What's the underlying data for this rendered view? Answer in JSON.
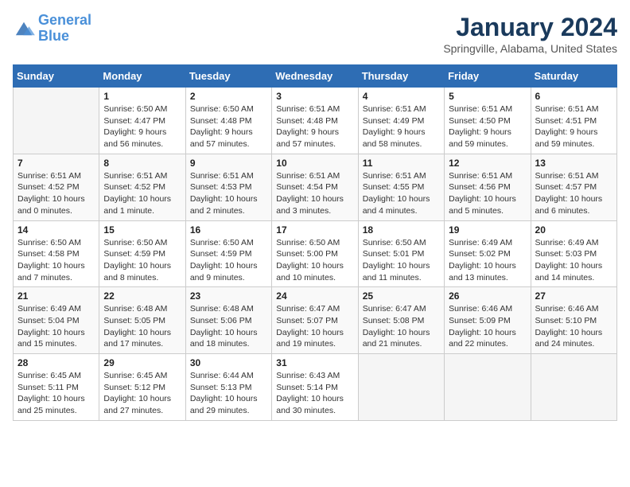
{
  "header": {
    "logo_line1": "General",
    "logo_line2": "Blue",
    "title": "January 2024",
    "subtitle": "Springville, Alabama, United States"
  },
  "weekdays": [
    "Sunday",
    "Monday",
    "Tuesday",
    "Wednesday",
    "Thursday",
    "Friday",
    "Saturday"
  ],
  "weeks": [
    [
      {
        "day": "",
        "info": ""
      },
      {
        "day": "1",
        "info": "Sunrise: 6:50 AM\nSunset: 4:47 PM\nDaylight: 9 hours\nand 56 minutes."
      },
      {
        "day": "2",
        "info": "Sunrise: 6:50 AM\nSunset: 4:48 PM\nDaylight: 9 hours\nand 57 minutes."
      },
      {
        "day": "3",
        "info": "Sunrise: 6:51 AM\nSunset: 4:48 PM\nDaylight: 9 hours\nand 57 minutes."
      },
      {
        "day": "4",
        "info": "Sunrise: 6:51 AM\nSunset: 4:49 PM\nDaylight: 9 hours\nand 58 minutes."
      },
      {
        "day": "5",
        "info": "Sunrise: 6:51 AM\nSunset: 4:50 PM\nDaylight: 9 hours\nand 59 minutes."
      },
      {
        "day": "6",
        "info": "Sunrise: 6:51 AM\nSunset: 4:51 PM\nDaylight: 9 hours\nand 59 minutes."
      }
    ],
    [
      {
        "day": "7",
        "info": "Sunrise: 6:51 AM\nSunset: 4:52 PM\nDaylight: 10 hours\nand 0 minutes."
      },
      {
        "day": "8",
        "info": "Sunrise: 6:51 AM\nSunset: 4:52 PM\nDaylight: 10 hours\nand 1 minute."
      },
      {
        "day": "9",
        "info": "Sunrise: 6:51 AM\nSunset: 4:53 PM\nDaylight: 10 hours\nand 2 minutes."
      },
      {
        "day": "10",
        "info": "Sunrise: 6:51 AM\nSunset: 4:54 PM\nDaylight: 10 hours\nand 3 minutes."
      },
      {
        "day": "11",
        "info": "Sunrise: 6:51 AM\nSunset: 4:55 PM\nDaylight: 10 hours\nand 4 minutes."
      },
      {
        "day": "12",
        "info": "Sunrise: 6:51 AM\nSunset: 4:56 PM\nDaylight: 10 hours\nand 5 minutes."
      },
      {
        "day": "13",
        "info": "Sunrise: 6:51 AM\nSunset: 4:57 PM\nDaylight: 10 hours\nand 6 minutes."
      }
    ],
    [
      {
        "day": "14",
        "info": "Sunrise: 6:50 AM\nSunset: 4:58 PM\nDaylight: 10 hours\nand 7 minutes."
      },
      {
        "day": "15",
        "info": "Sunrise: 6:50 AM\nSunset: 4:59 PM\nDaylight: 10 hours\nand 8 minutes."
      },
      {
        "day": "16",
        "info": "Sunrise: 6:50 AM\nSunset: 4:59 PM\nDaylight: 10 hours\nand 9 minutes."
      },
      {
        "day": "17",
        "info": "Sunrise: 6:50 AM\nSunset: 5:00 PM\nDaylight: 10 hours\nand 10 minutes."
      },
      {
        "day": "18",
        "info": "Sunrise: 6:50 AM\nSunset: 5:01 PM\nDaylight: 10 hours\nand 11 minutes."
      },
      {
        "day": "19",
        "info": "Sunrise: 6:49 AM\nSunset: 5:02 PM\nDaylight: 10 hours\nand 13 minutes."
      },
      {
        "day": "20",
        "info": "Sunrise: 6:49 AM\nSunset: 5:03 PM\nDaylight: 10 hours\nand 14 minutes."
      }
    ],
    [
      {
        "day": "21",
        "info": "Sunrise: 6:49 AM\nSunset: 5:04 PM\nDaylight: 10 hours\nand 15 minutes."
      },
      {
        "day": "22",
        "info": "Sunrise: 6:48 AM\nSunset: 5:05 PM\nDaylight: 10 hours\nand 17 minutes."
      },
      {
        "day": "23",
        "info": "Sunrise: 6:48 AM\nSunset: 5:06 PM\nDaylight: 10 hours\nand 18 minutes."
      },
      {
        "day": "24",
        "info": "Sunrise: 6:47 AM\nSunset: 5:07 PM\nDaylight: 10 hours\nand 19 minutes."
      },
      {
        "day": "25",
        "info": "Sunrise: 6:47 AM\nSunset: 5:08 PM\nDaylight: 10 hours\nand 21 minutes."
      },
      {
        "day": "26",
        "info": "Sunrise: 6:46 AM\nSunset: 5:09 PM\nDaylight: 10 hours\nand 22 minutes."
      },
      {
        "day": "27",
        "info": "Sunrise: 6:46 AM\nSunset: 5:10 PM\nDaylight: 10 hours\nand 24 minutes."
      }
    ],
    [
      {
        "day": "28",
        "info": "Sunrise: 6:45 AM\nSunset: 5:11 PM\nDaylight: 10 hours\nand 25 minutes."
      },
      {
        "day": "29",
        "info": "Sunrise: 6:45 AM\nSunset: 5:12 PM\nDaylight: 10 hours\nand 27 minutes."
      },
      {
        "day": "30",
        "info": "Sunrise: 6:44 AM\nSunset: 5:13 PM\nDaylight: 10 hours\nand 29 minutes."
      },
      {
        "day": "31",
        "info": "Sunrise: 6:43 AM\nSunset: 5:14 PM\nDaylight: 10 hours\nand 30 minutes."
      },
      {
        "day": "",
        "info": ""
      },
      {
        "day": "",
        "info": ""
      },
      {
        "day": "",
        "info": ""
      }
    ]
  ]
}
